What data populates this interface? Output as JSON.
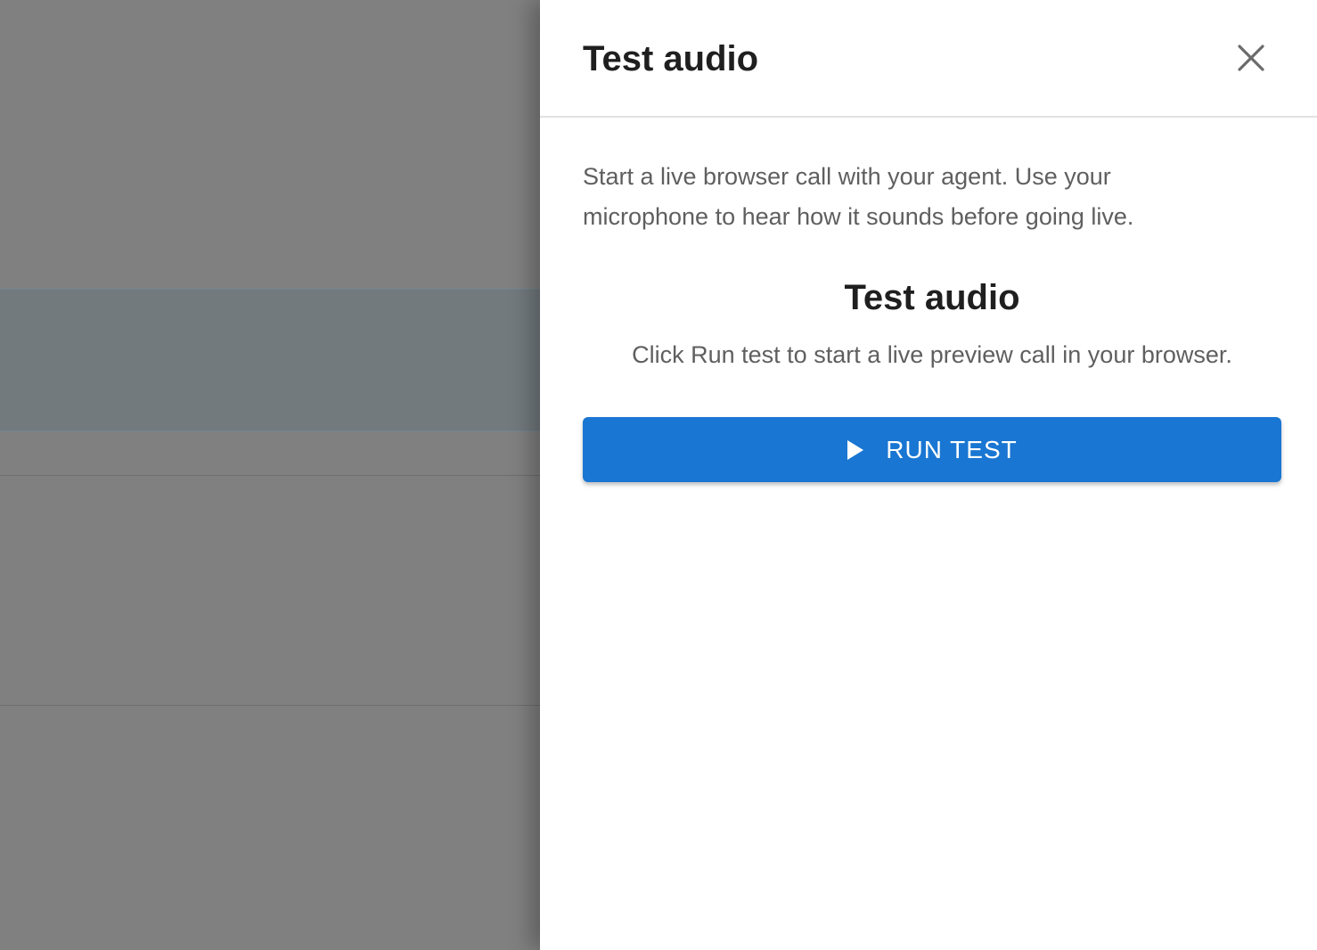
{
  "drawer": {
    "title": "Test audio",
    "close_icon": "close-icon",
    "intro": "Start a live browser call with your agent. Use your microphone to hear how it sounds before going live.",
    "section": {
      "title": "Test audio",
      "description": "Click Run test to start a live preview call in your browser."
    },
    "run_button": {
      "label": "RUN TEST",
      "icon": "play-icon",
      "color": "#1976d2"
    }
  },
  "colors": {
    "overlay": "#808080",
    "text_primary": "#1f1f1f",
    "text_secondary": "#5f5f5f"
  }
}
